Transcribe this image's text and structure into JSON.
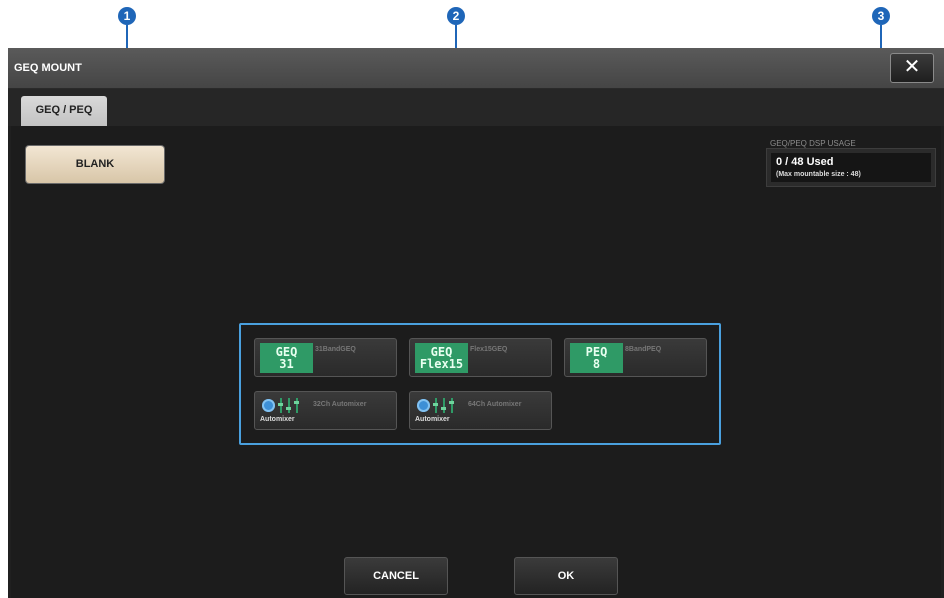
{
  "callouts": [
    "1",
    "2",
    "3"
  ],
  "window": {
    "title": "GEQ MOUNT",
    "close_label": "✕"
  },
  "tabs": [
    {
      "label": "GEQ / PEQ",
      "active": true
    }
  ],
  "blank_button": {
    "label": "BLANK"
  },
  "dsp_usage": {
    "label": "GEQ/PEQ DSP USAGE",
    "used_text": "0 / 48 Used",
    "max_text": "(Max mountable size : 48)"
  },
  "modules": [
    {
      "icon_lines": [
        "GEQ",
        "31"
      ],
      "label": "31BandGEQ"
    },
    {
      "icon_lines": [
        "GEQ",
        "Flex15"
      ],
      "label": "Flex15GEQ"
    },
    {
      "icon_lines": [
        "PEQ",
        "8"
      ],
      "label": "8BandPEQ"
    },
    {
      "icon_text": "Automixer",
      "label": "32Ch Automixer"
    },
    {
      "icon_text": "Automixer",
      "label": "64Ch Automixer"
    }
  ],
  "footer": {
    "cancel_label": "CANCEL",
    "ok_label": "OK"
  },
  "colors": {
    "callout": "#1f66b8",
    "module_green": "#2f9a66",
    "frame_blue": "#4aa0de",
    "blank_button": "#f2e6d3"
  }
}
